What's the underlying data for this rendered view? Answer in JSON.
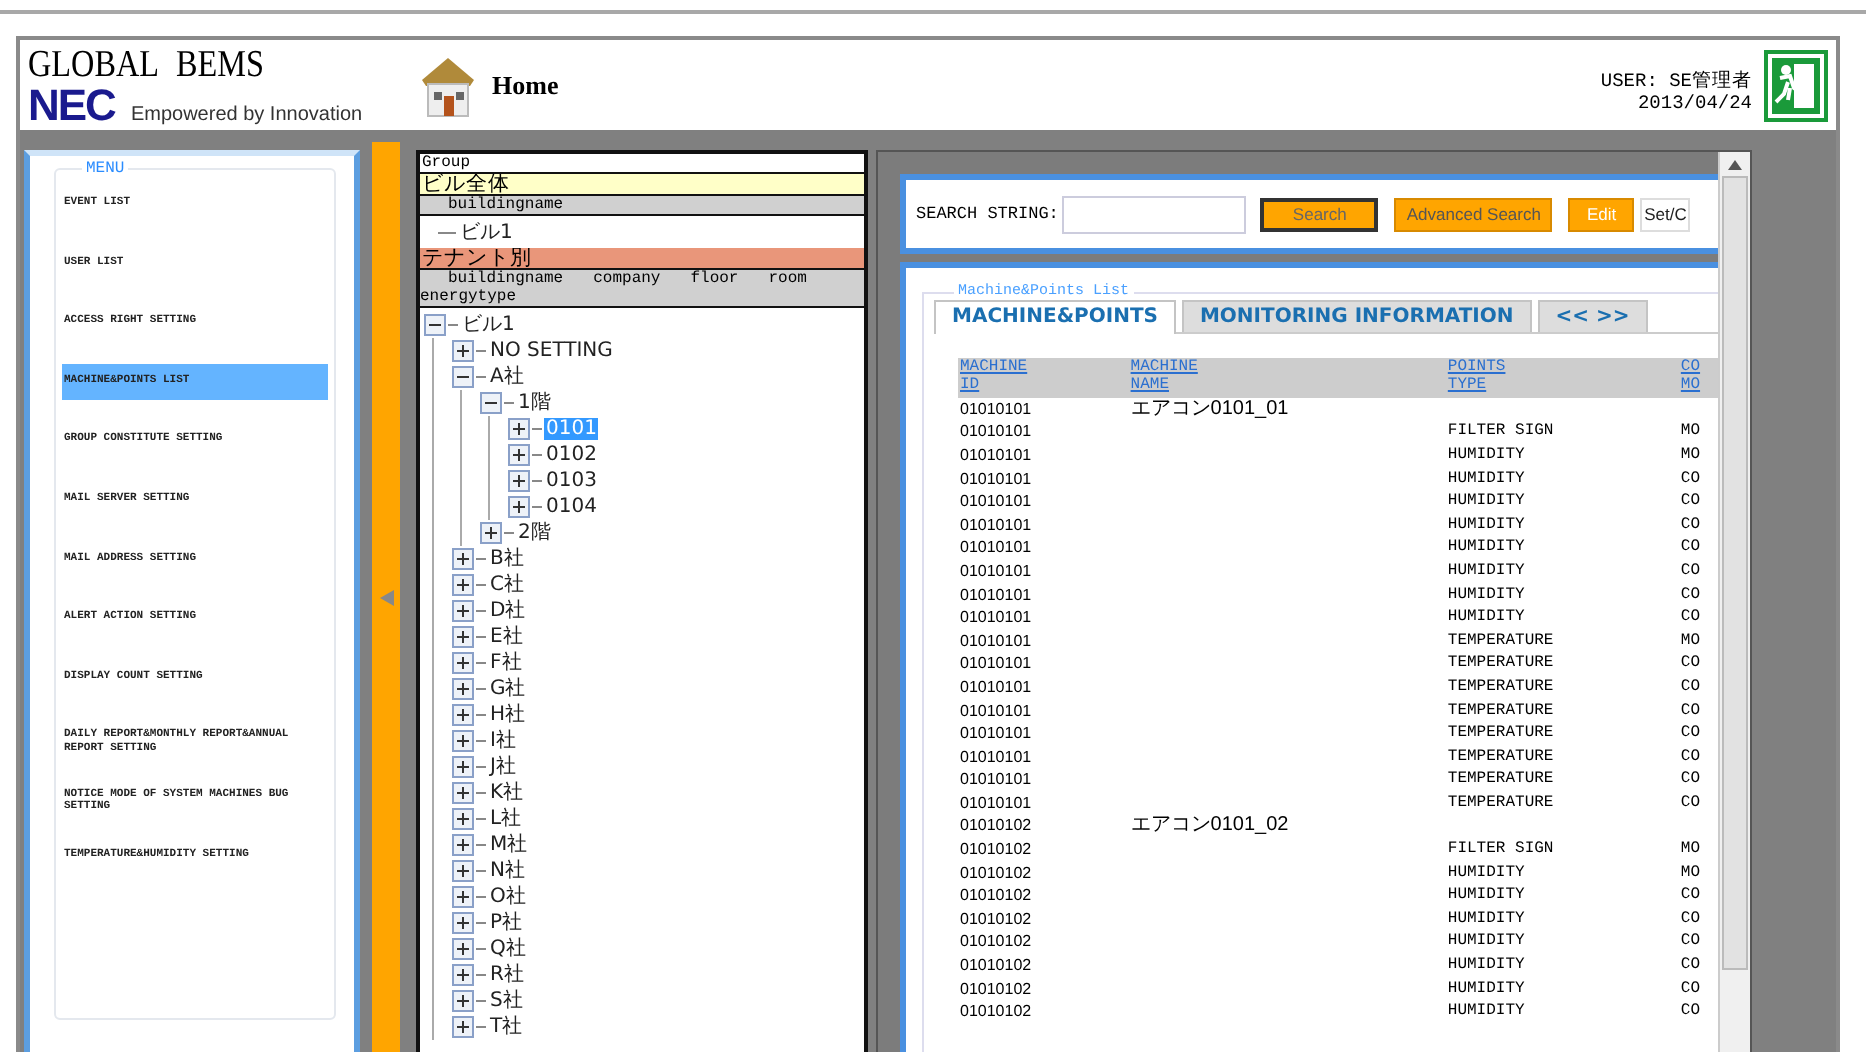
{
  "header": {
    "logo_title": "GLOBAL BEMS",
    "logo_brand": "NEC",
    "tagline": "Empowered by Innovation",
    "home_label": "Home",
    "user": "USER: SE管理者",
    "date": "2013/04/24"
  },
  "menu": {
    "legend": "MENU",
    "items": [
      {
        "label": "EVENT LIST",
        "selected": false
      },
      {
        "label": "USER LIST",
        "selected": false
      },
      {
        "label": "ACCESS RIGHT SETTING",
        "selected": false
      },
      {
        "label": "MACHINE&POINTS LIST",
        "selected": true
      },
      {
        "label": "GROUP CONSTITUTE SETTING",
        "selected": false
      },
      {
        "label": "MAIL SERVER SETTING",
        "selected": false
      },
      {
        "label": "MAIL ADDRESS SETTING",
        "selected": false
      },
      {
        "label": "ALERT ACTION SETTING",
        "selected": false
      },
      {
        "label": "DISPLAY COUNT SETTING",
        "selected": false
      },
      {
        "label": "DAILY REPORT&MONTHLY REPORT&ANNUAL REPORT SETTING",
        "selected": false
      },
      {
        "label": "NOTICE MODE OF SYSTEM MACHINES BUG SETTING",
        "selected": false
      },
      {
        "label": "TEMPERATURE&HUMIDITY SETTING",
        "selected": false
      }
    ]
  },
  "group_panel": {
    "title": "Group",
    "sections": [
      {
        "title": "ビル全体",
        "color": "#ffffc8",
        "columns": [
          "buildingname"
        ],
        "tree": [
          {
            "label": "ビル1",
            "selected": false
          }
        ]
      },
      {
        "title": "テナント別",
        "color": "#e9967a",
        "columns": [
          "buildingname",
          "company",
          "floor",
          "room",
          "energytype"
        ],
        "tree": [
          {
            "label": "ビル1",
            "expanded": true,
            "selected": false,
            "children": [
              {
                "label": "NO SETTING",
                "expanded": false,
                "selected": false
              },
              {
                "label": "A社",
                "expanded": true,
                "selected": false,
                "children": [
                  {
                    "label": "1階",
                    "expanded": true,
                    "selected": false,
                    "children": [
                      {
                        "label": "0101",
                        "expanded": false,
                        "selected": true
                      },
                      {
                        "label": "0102",
                        "expanded": false,
                        "selected": false
                      },
                      {
                        "label": "0103",
                        "expanded": false,
                        "selected": false
                      },
                      {
                        "label": "0104",
                        "expanded": false,
                        "selected": false
                      }
                    ]
                  },
                  {
                    "label": "2階",
                    "expanded": false,
                    "selected": false
                  }
                ]
              },
              {
                "label": "B社",
                "expanded": false,
                "selected": false
              },
              {
                "label": "C社",
                "expanded": false,
                "selected": false
              },
              {
                "label": "D社",
                "expanded": false,
                "selected": false
              },
              {
                "label": "E社",
                "expanded": false,
                "selected": false
              },
              {
                "label": "F社",
                "expanded": false,
                "selected": false
              },
              {
                "label": "G社",
                "expanded": false,
                "selected": false
              },
              {
                "label": "H社",
                "expanded": false,
                "selected": false
              },
              {
                "label": "I社",
                "expanded": false,
                "selected": false
              },
              {
                "label": "J社",
                "expanded": false,
                "selected": false
              },
              {
                "label": "K社",
                "expanded": false,
                "selected": false
              },
              {
                "label": "L社",
                "expanded": false,
                "selected": false
              },
              {
                "label": "M社",
                "expanded": false,
                "selected": false
              },
              {
                "label": "N社",
                "expanded": false,
                "selected": false
              },
              {
                "label": "O社",
                "expanded": false,
                "selected": false
              },
              {
                "label": "P社",
                "expanded": false,
                "selected": false
              },
              {
                "label": "Q社",
                "expanded": false,
                "selected": false
              },
              {
                "label": "R社",
                "expanded": false,
                "selected": false
              },
              {
                "label": "S社",
                "expanded": false,
                "selected": false
              },
              {
                "label": "T社",
                "expanded": false,
                "selected": false
              }
            ]
          }
        ]
      }
    ]
  },
  "search": {
    "label": "SEARCH STRING:",
    "buttons": [
      {
        "label": "Search",
        "kind": "focused"
      },
      {
        "label": "Advanced Search",
        "kind": "normal"
      },
      {
        "label": "Edit",
        "kind": "disabled"
      },
      {
        "label": "Set/C",
        "kind": "plain"
      }
    ]
  },
  "list": {
    "legend": "Machine&Points List",
    "tabs": [
      {
        "label": "MACHINE&POINTS",
        "selected": true
      },
      {
        "label": "MONITORING INFORMATION",
        "selected": false
      },
      {
        "label": "<< >>",
        "selected": false
      }
    ],
    "columns": [
      "MACHINE ID",
      "MACHINE NAME",
      "POINTS TYPE",
      "CO MO"
    ],
    "rows": [
      {
        "id": "01010101",
        "name": "エアコン0101_01"
      },
      {
        "id": "01010101",
        "type": "FILTER SIGN",
        "mode": "MO"
      },
      {
        "id": "01010101",
        "type": "HUMIDITY",
        "mode": "MO"
      },
      {
        "id": "01010101",
        "type": "HUMIDITY",
        "mode": "CO"
      },
      {
        "id": "01010101",
        "type": "HUMIDITY",
        "mode": "CO"
      },
      {
        "id": "01010101",
        "type": "HUMIDITY",
        "mode": "CO"
      },
      {
        "id": "01010101",
        "type": "HUMIDITY",
        "mode": "CO"
      },
      {
        "id": "01010101",
        "type": "HUMIDITY",
        "mode": "CO"
      },
      {
        "id": "01010101",
        "type": "HUMIDITY",
        "mode": "CO"
      },
      {
        "id": "01010101",
        "type": "HUMIDITY",
        "mode": "CO"
      },
      {
        "id": "01010101",
        "type": "TEMPERATURE",
        "mode": "MO"
      },
      {
        "id": "01010101",
        "type": "TEMPERATURE",
        "mode": "CO"
      },
      {
        "id": "01010101",
        "type": "TEMPERATURE",
        "mode": "CO"
      },
      {
        "id": "01010101",
        "type": "TEMPERATURE",
        "mode": "CO"
      },
      {
        "id": "01010101",
        "type": "TEMPERATURE",
        "mode": "CO"
      },
      {
        "id": "01010101",
        "type": "TEMPERATURE",
        "mode": "CO"
      },
      {
        "id": "01010101",
        "type": "TEMPERATURE",
        "mode": "CO"
      },
      {
        "id": "01010101",
        "type": "TEMPERATURE",
        "mode": "CO"
      },
      {
        "id": "01010102",
        "name": "エアコン0101_02"
      },
      {
        "id": "01010102",
        "type": "FILTER SIGN",
        "mode": "MO"
      },
      {
        "id": "01010102",
        "type": "HUMIDITY",
        "mode": "MO"
      },
      {
        "id": "01010102",
        "type": "HUMIDITY",
        "mode": "CO"
      },
      {
        "id": "01010102",
        "type": "HUMIDITY",
        "mode": "CO"
      },
      {
        "id": "01010102",
        "type": "HUMIDITY",
        "mode": "CO"
      },
      {
        "id": "01010102",
        "type": "HUMIDITY",
        "mode": "CO"
      },
      {
        "id": "01010102",
        "type": "HUMIDITY",
        "mode": "CO"
      },
      {
        "id": "01010102",
        "type": "HUMIDITY",
        "mode": "CO"
      }
    ]
  }
}
